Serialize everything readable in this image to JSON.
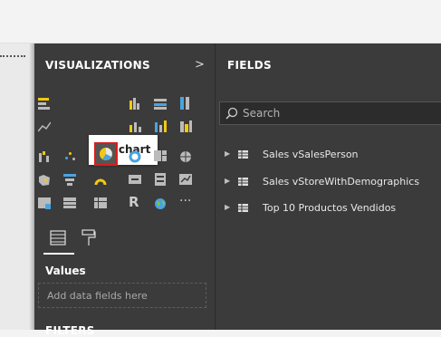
{
  "visualizations": {
    "title": "VISUALIZATIONS",
    "chevron": ">",
    "tooltip": "Pie chart",
    "values_label": "Values",
    "dropzone_placeholder": "Add data fields here",
    "filters_label": "FILTERS",
    "more_glyph": "···",
    "r_glyph": "R",
    "icons": [
      "stacked-bar-icon",
      "stacked-column-icon",
      "clustered-bar-icon",
      "clustered-column-icon",
      "100-stacked-bar-icon",
      "100-stacked-column-icon",
      "line-chart-icon",
      "area-chart-icon",
      "stacked-area-icon",
      "line-column-icon",
      "line-clustered-column-icon",
      "ribbon-chart-icon",
      "waterfall-icon",
      "scatter-icon",
      "pie-chart-icon",
      "donut-icon",
      "treemap-icon",
      "map-icon",
      "filled-map-icon",
      "funnel-icon",
      "gauge-icon",
      "card-icon",
      "multirow-card-icon",
      "kpi-icon",
      "slicer-icon",
      "table-icon",
      "matrix-icon",
      "r-visual-icon",
      "globe-icon",
      "more-icon"
    ]
  },
  "fields": {
    "title": "FIELDS",
    "search_placeholder": "Search",
    "tables": [
      {
        "name": "Sales vSalesPerson"
      },
      {
        "name": "Sales vStoreWithDemographics"
      },
      {
        "name": "Top 10 Productos Vendidos"
      }
    ]
  },
  "colors": {
    "panel_bg": "#3b3b3b",
    "highlight": "#e01a1a",
    "accent_yellow": "#f2c811",
    "accent_blue": "#4aa3df"
  }
}
